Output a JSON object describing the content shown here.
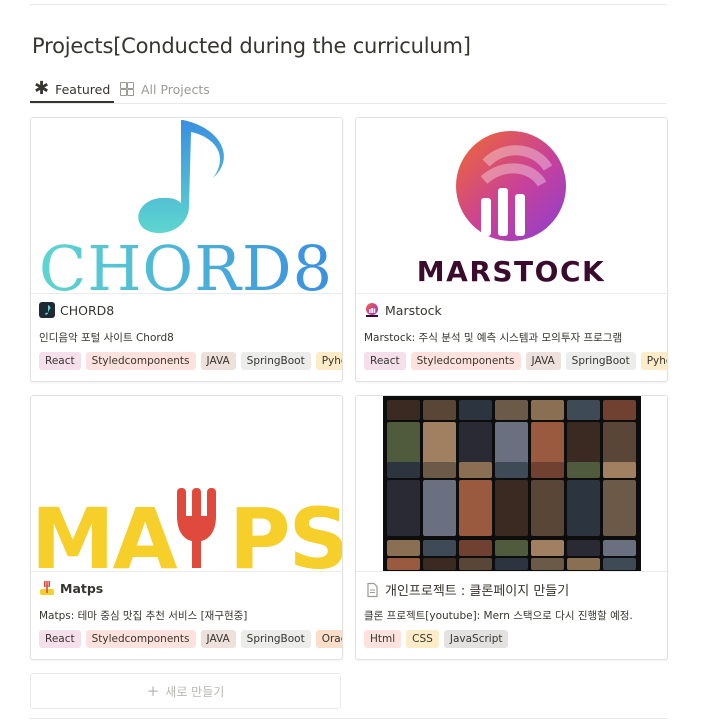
{
  "page": {
    "title": "Projects[Conducted during the curriculum]"
  },
  "tabs": [
    {
      "label": "Featured",
      "icon": "asterisk-icon",
      "active": true
    },
    {
      "label": "All Projects",
      "icon": "gallery-grid-icon",
      "active": false
    }
  ],
  "cards": [
    {
      "title": "CHORD8",
      "description": "인디음악 포털 사이트 Chord8",
      "cover_text": "CHORD8",
      "tags": [
        {
          "label": "React",
          "color": "#f4dfeb"
        },
        {
          "label": "Styledcomponents",
          "color": "#ffe2dd"
        },
        {
          "label": "JAVA",
          "color": "#eee0da"
        },
        {
          "label": "SpringBoot",
          "color": "#ececeb"
        },
        {
          "label": "Pyhon",
          "color": "#fdecc8"
        }
      ]
    },
    {
      "title": "Marstock",
      "description": "Marstock: 주식 분석 및 예측 시스템과 모의투자 프로그램",
      "cover_text": "MARSTOCK",
      "tags": [
        {
          "label": "React",
          "color": "#f4dfeb"
        },
        {
          "label": "Styledcomponents",
          "color": "#ffe2dd"
        },
        {
          "label": "JAVA",
          "color": "#eee0da"
        },
        {
          "label": "SpringBoot",
          "color": "#ececeb"
        },
        {
          "label": "Pyhon",
          "color": "#fdecc8"
        }
      ]
    },
    {
      "title": "Matps",
      "description": "Matps: 테마 중심 맛집 추천 서비스 [재구현중]",
      "cover_text_left": "MA",
      "cover_text_right": "PS",
      "tags": [
        {
          "label": "React",
          "color": "#f4dfeb"
        },
        {
          "label": "Styledcomponents",
          "color": "#ffe2dd"
        },
        {
          "label": "JAVA",
          "color": "#eee0da"
        },
        {
          "label": "SpringBoot",
          "color": "#ececeb"
        },
        {
          "label": "Oracle",
          "color": "#fadec9"
        }
      ]
    },
    {
      "title": "개인프로젝트 :  클론페이지 만들기",
      "description": "클론 프로젝트[youtube]: Mern 스택으로 다시 진행할 예정.",
      "tags": [
        {
          "label": "Html",
          "color": "#ffe2dd"
        },
        {
          "label": "CSS",
          "color": "#fdecc8"
        },
        {
          "label": "JavaScript",
          "color": "#e3e2e0"
        }
      ]
    }
  ],
  "new_button": {
    "label": "새로 만들기",
    "icon": "plus-icon"
  },
  "colors": {
    "text": "#37352f",
    "muted": "#9b9a97",
    "chord_blue": "#3a8fe0",
    "chord_teal": "#5ed6cf",
    "marstock_orange": "#f06a2e",
    "marstock_purple": "#8a3fd1",
    "marstock_text": "#3a0b2c",
    "matps_yellow": "#f6cf2a",
    "matps_red": "#e04a3d"
  }
}
